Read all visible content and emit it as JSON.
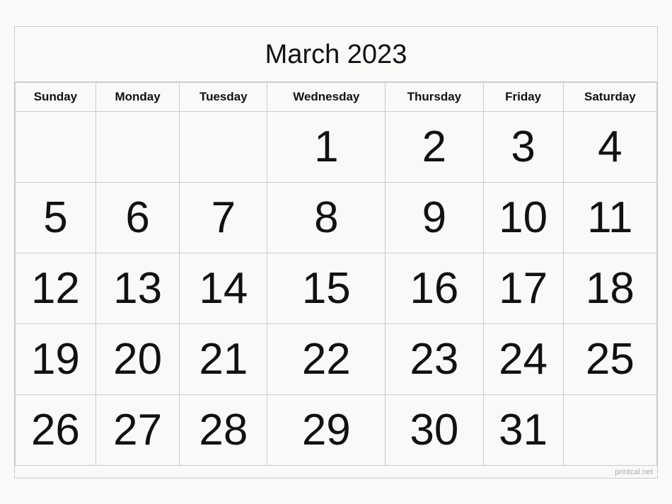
{
  "calendar": {
    "title": "March 2023",
    "days_of_week": [
      "Sunday",
      "Monday",
      "Tuesday",
      "Wednesday",
      "Thursday",
      "Friday",
      "Saturday"
    ],
    "weeks": [
      [
        "",
        "",
        "",
        "1",
        "2",
        "3",
        "4"
      ],
      [
        "5",
        "6",
        "7",
        "8",
        "9",
        "10",
        "11"
      ],
      [
        "12",
        "13",
        "14",
        "15",
        "16",
        "17",
        "18"
      ],
      [
        "19",
        "20",
        "21",
        "22",
        "23",
        "24",
        "25"
      ],
      [
        "26",
        "27",
        "28",
        "29",
        "30",
        "31",
        ""
      ]
    ],
    "watermark": "printcal.net"
  }
}
